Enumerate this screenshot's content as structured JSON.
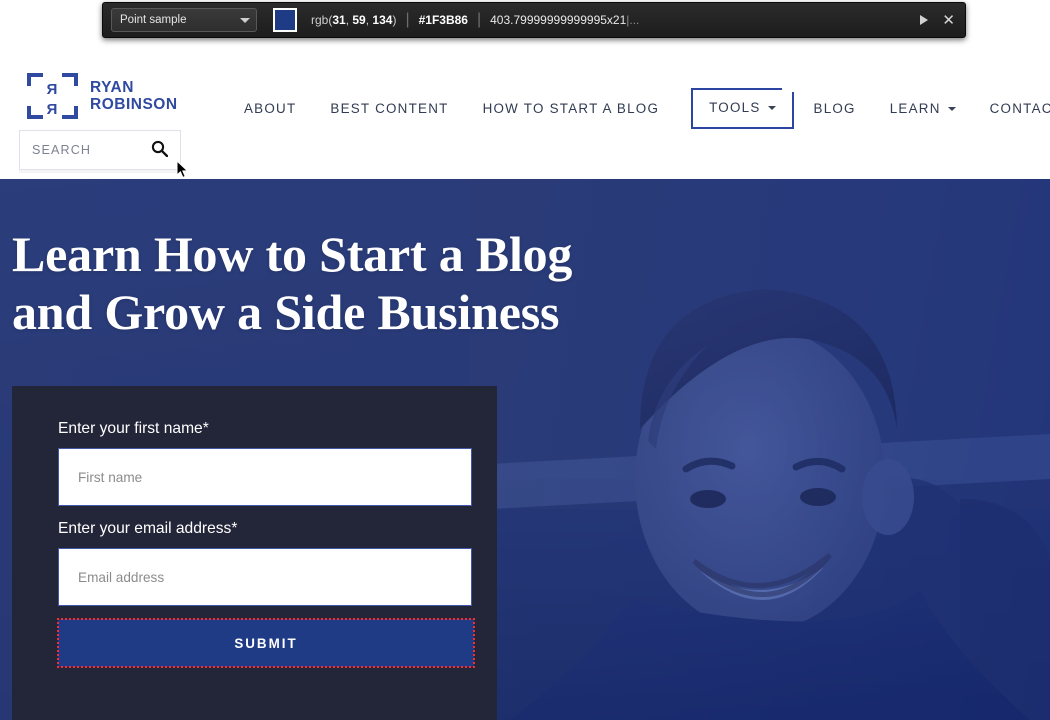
{
  "picker": {
    "mode_label": "Point sample",
    "mode_icon": "chevron-down-icon",
    "swatch_color": "#1F3B86",
    "rgb_prefix": "rgb(",
    "rgb_r": "31",
    "rgb_g": "59",
    "rgb_b": "134",
    "rgb_suffix": ")",
    "hex": "#1F3B86",
    "dimensions": "403.79999999999995x21",
    "ellipsis": "|...",
    "expand_icon": "play-triangle-icon",
    "close_icon": "close-icon",
    "separator": "|"
  },
  "header": {
    "logo": {
      "line1": "RYAN",
      "line2": "ROBINSON",
      "mark_letter": "R",
      "color": "#2F4AA0"
    },
    "nav": [
      {
        "label": "ABOUT",
        "has_dropdown": false,
        "active": false
      },
      {
        "label": "BEST CONTENT",
        "has_dropdown": false,
        "active": false
      },
      {
        "label": "HOW TO START A BLOG",
        "has_dropdown": false,
        "active": false
      },
      {
        "label": "TOOLS",
        "has_dropdown": true,
        "active": true
      },
      {
        "label": "BLOG",
        "has_dropdown": false,
        "active": false
      },
      {
        "label": "LEARN",
        "has_dropdown": true,
        "active": false
      },
      {
        "label": "CONTACT",
        "has_dropdown": false,
        "active": false
      }
    ],
    "search": {
      "placeholder": "SEARCH",
      "value": "",
      "icon": "search-icon"
    }
  },
  "hero": {
    "headline_line1": "Learn How to Start a Blog",
    "headline_line2": "and Grow a Side Business",
    "background_color": "#4D5F99",
    "accent_color": "#1F3B86"
  },
  "form": {
    "first_name_label": "Enter your first name*",
    "first_name_placeholder": "First name",
    "first_name_value": "",
    "email_label": "Enter your email address*",
    "email_placeholder": "Email address",
    "email_value": "",
    "submit_label": "SUBMIT",
    "submit_bg": "#1F3B86",
    "selection_outline_color": "#FF2B2B",
    "panel_bg": "#232539"
  }
}
